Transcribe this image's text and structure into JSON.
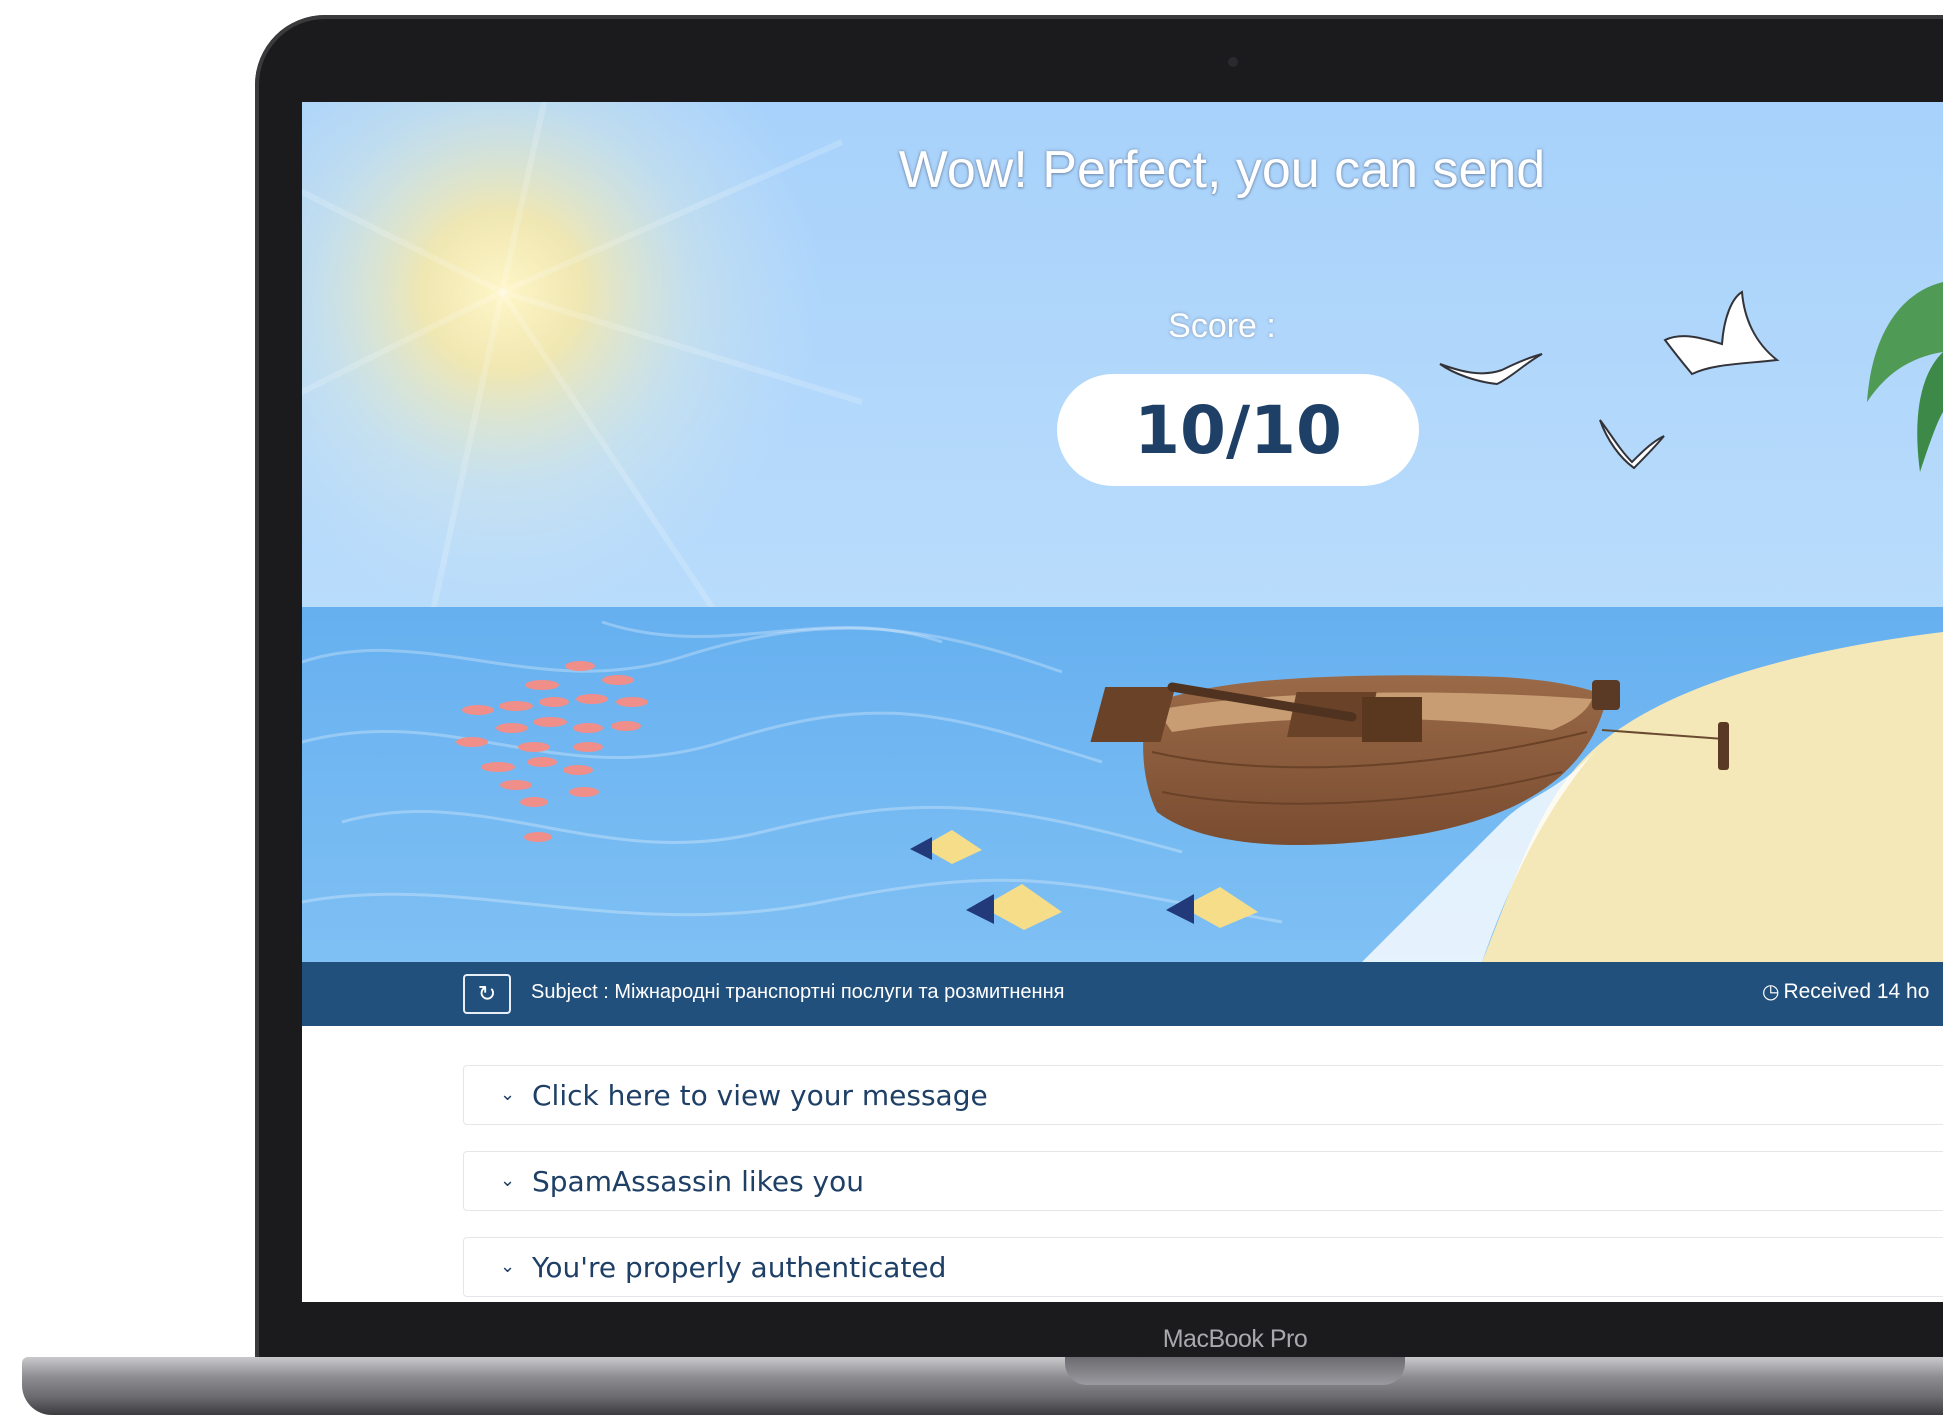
{
  "hero": {
    "headline": "Wow! Perfect, you can send",
    "score_label": "Score :",
    "score_value": "10/10"
  },
  "subject_bar": {
    "refresh_icon": "refresh-icon",
    "subject": "Subject : Міжнародні транспортні послуги та розмитнення",
    "received": "Received 14 ho",
    "clock_icon": "clock-icon"
  },
  "sections": [
    {
      "label": "Click here to view your message"
    },
    {
      "label": "SpamAssassin likes you"
    },
    {
      "label": "You're properly authenticated"
    }
  ],
  "device": {
    "label": "MacBook Pro"
  },
  "colors": {
    "brand_dark": "#22507d",
    "text_dark": "#1e3f66",
    "sky": "#a8d2fb",
    "sea": "#70b6f2",
    "sand": "#f4e8b8",
    "boat": "#8a5a3b"
  }
}
